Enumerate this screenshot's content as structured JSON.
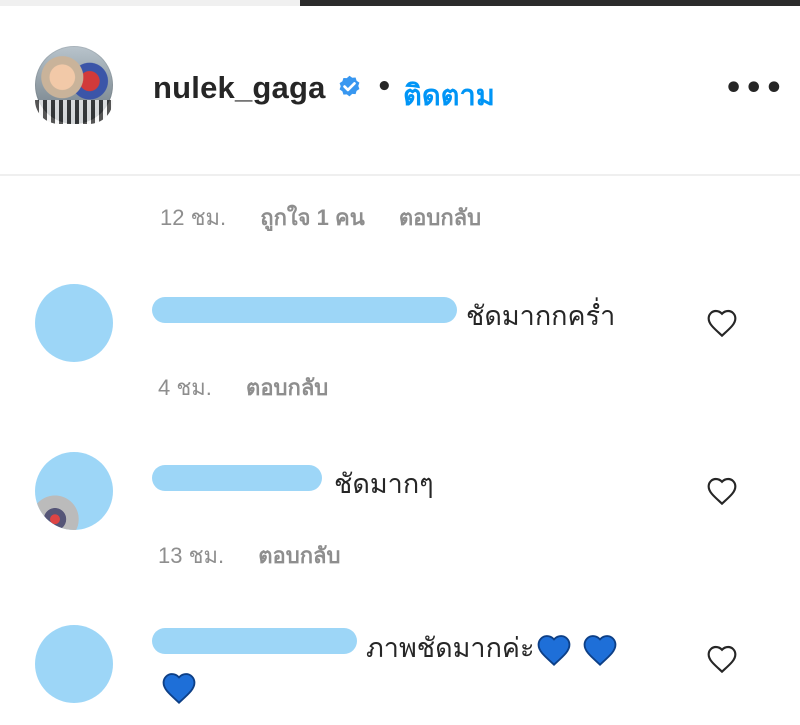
{
  "post_header": {
    "username": "nulek_gaga",
    "separator": "•",
    "follow_label": "ติดตาม",
    "more_label": "•••"
  },
  "top_comment_meta": {
    "time": "12 ชม.",
    "likes": "ถูกใจ 1 คน",
    "reply": "ตอบกลับ"
  },
  "comments": [
    {
      "text": "ชัดมากกคร่ำ",
      "time": "4 ชม.",
      "reply": "ตอบกลับ"
    },
    {
      "text": "ชัดมากๆ",
      "time": "13 ชม.",
      "reply": "ตอบกลับ"
    },
    {
      "text": "ภาพชัดมากค่ะ",
      "time": "",
      "reply": ""
    }
  ],
  "colors": {
    "accent": "#0095f6",
    "redaction": "#9dd6f7",
    "heart_emoji": "#1e6fd8",
    "muted": "#8e8e8e"
  },
  "icons": {
    "verified": "verified-badge-icon",
    "more": "more-options-icon",
    "like": "heart-outline-icon",
    "emoji": "blue-heart-emoji"
  }
}
